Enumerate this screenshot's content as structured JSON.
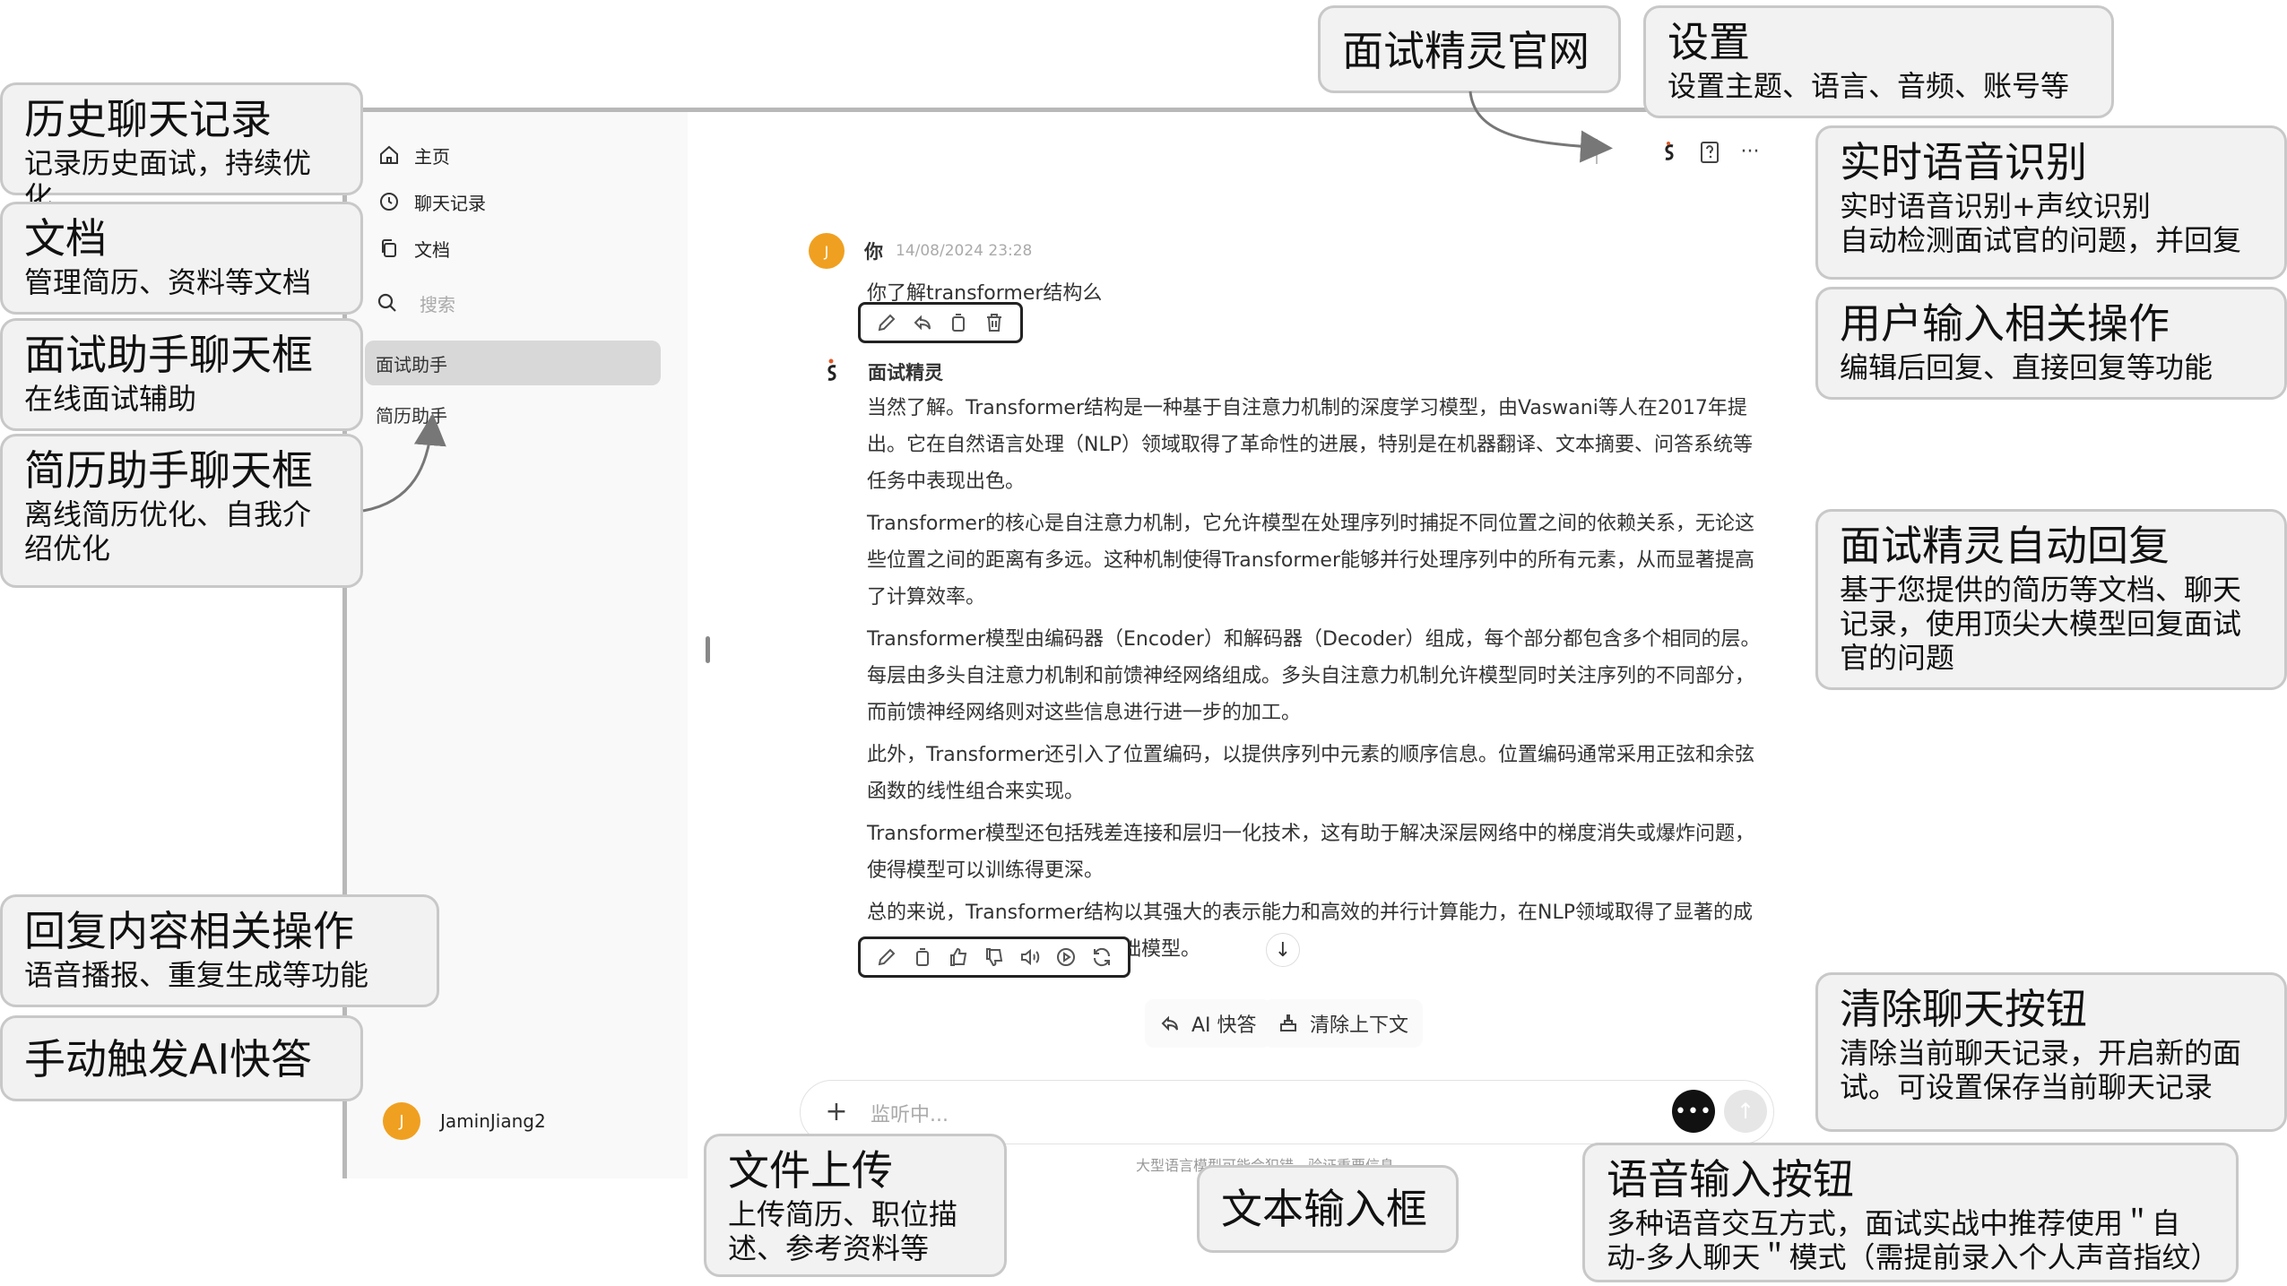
{
  "sidebar": {
    "nav": [
      {
        "label": "主页",
        "icon": "home-icon"
      },
      {
        "label": "聊天记录",
        "icon": "history-icon"
      },
      {
        "label": "文档",
        "icon": "documents-icon"
      }
    ],
    "search_placeholder": "搜索",
    "chats": [
      {
        "label": "面试助手",
        "active": true
      },
      {
        "label": "简历助手",
        "active": false
      }
    ],
    "user": {
      "avatar": "J",
      "name": "JaminJiang2"
    }
  },
  "header": {
    "icons": [
      "logo-icon",
      "help-icon",
      "more-icon"
    ]
  },
  "conversation": {
    "user_message": {
      "avatar": "J",
      "sender": "你",
      "timestamp": "14/08/2024 23:28",
      "text": "你了解transformer结构么",
      "actions": [
        "edit-icon",
        "reply-icon",
        "copy-icon",
        "delete-icon"
      ]
    },
    "assistant_message": {
      "sender": "面试精灵",
      "paragraphs": [
        "当然了解。Transformer结构是一种基于自注意力机制的深度学习模型，由Vaswani等人在2017年提出。它在自然语言处理（NLP）领域取得了革命性的进展，特别是在机器翻译、文本摘要、问答系统等任务中表现出色。",
        "Transformer的核心是自注意力机制，它允许模型在处理序列时捕捉不同位置之间的依赖关系，无论这些位置之间的距离有多远。这种机制使得Transformer能够并行处理序列中的所有元素，从而显著提高了计算效率。",
        "Transformer模型由编码器（Encoder）和解码器（Decoder）组成，每个部分都包含多个相同的层。每层由多头自注意力机制和前馈神经网络组成。多头自注意力机制允许模型同时关注序列的不同部分，而前馈神经网络则对这些信息进行进一步的加工。",
        "此外，Transformer还引入了位置编码，以提供序列中元素的顺序信息。位置编码通常采用正弦和余弦函数的线性组合来实现。",
        "Transformer模型还包括残差连接和层归一化技术，这有助于解决深层网络中的梯度消失或爆炸问题，使得模型可以训练得更深。",
        "总的来说，Transformer结构以其强大的表示能力和高效的并行计算能力，在NLP领域取得了显著的成果，成为了许多NLP任务的基础模型。"
      ],
      "actions": [
        "edit-icon",
        "copy-icon",
        "thumbs-up-icon",
        "thumbs-down-icon",
        "speaker-icon",
        "play-icon",
        "regenerate-icon"
      ]
    }
  },
  "quick_actions": {
    "ai_quick": "AI 快答",
    "clear_context": "清除上下文"
  },
  "input": {
    "placeholder": "监听中...",
    "voice_label": "•••",
    "send_label": "↑"
  },
  "disclaimer": "大型语言模型可能会犯错。验证重要信息。",
  "callouts": [
    {
      "id": "history",
      "title": "历史聊天记录",
      "desc": "记录历史面试，持续优化"
    },
    {
      "id": "docs",
      "title": "文档",
      "desc": "管理简历、资料等文档"
    },
    {
      "id": "interview-chat",
      "title": "面试助手聊天框",
      "desc": "在线面试辅助"
    },
    {
      "id": "resume-chat",
      "title": "简历助手聊天框",
      "desc": "离线简历优化、自我介绍优化"
    },
    {
      "id": "reply-ops",
      "title": "回复内容相关操作",
      "desc": "语音播报、重复生成等功能"
    },
    {
      "id": "manual-ai",
      "title": "手动触发AI快答",
      "desc": ""
    },
    {
      "id": "website",
      "title": "面试精灵官网",
      "desc": ""
    },
    {
      "id": "settings",
      "title": "设置",
      "desc": "设置主题、语言、音频、账号等"
    },
    {
      "id": "asr",
      "title": "实时语音识别",
      "desc": "实时语音识别+声纹识别\n自动检测面试官的问题，并回复"
    },
    {
      "id": "user-ops",
      "title": "用户输入相关操作",
      "desc": "编辑后回复、直接回复等功能"
    },
    {
      "id": "auto-reply",
      "title": "面试精灵自动回复",
      "desc": "基于您提供的简历等文档、聊天记录，使用顶尖大模型回复面试官的问题"
    },
    {
      "id": "clear-chat",
      "title": "清除聊天按钮",
      "desc": "清除当前聊天记录，开启新的面试。可设置保存当前聊天记录"
    },
    {
      "id": "file-upload",
      "title": "文件上传",
      "desc": "上传简历、职位描述、参考资料等"
    },
    {
      "id": "text-input",
      "title": "文本输入框",
      "desc": ""
    },
    {
      "id": "voice-input",
      "title": "语音输入按钮",
      "desc": "多种语音交互方式，面试实战中推荐使用＂自动-多人聊天＂模式（需提前录入个人声音指纹）"
    }
  ]
}
